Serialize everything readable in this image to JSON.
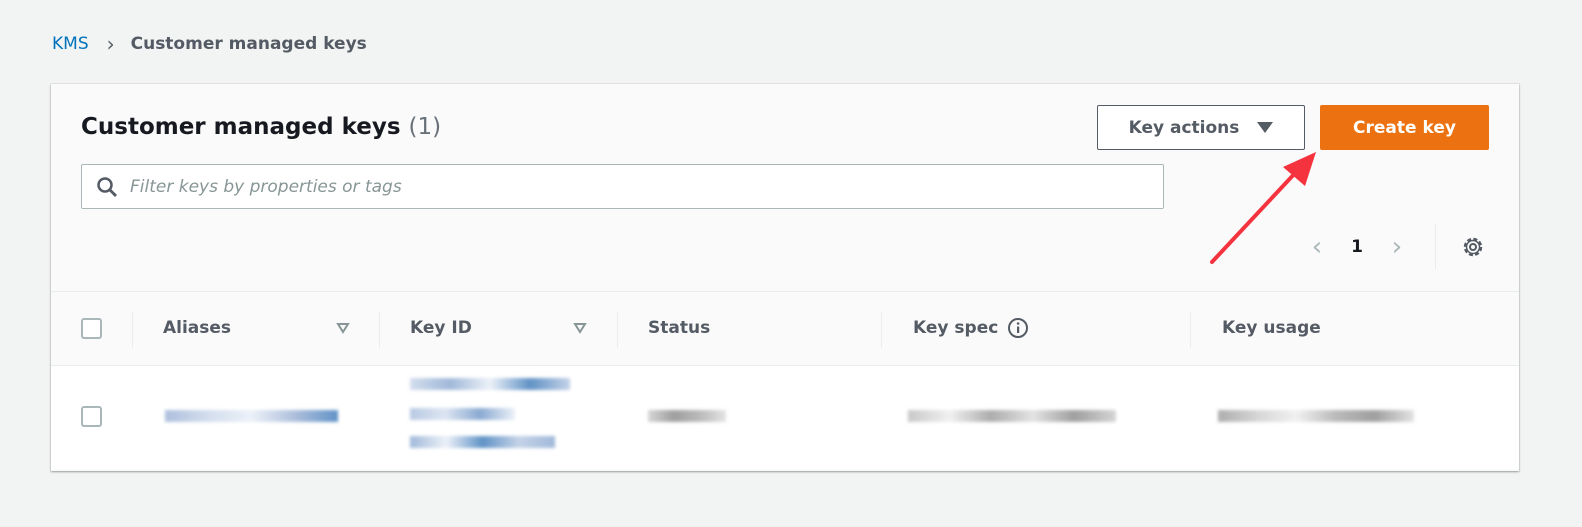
{
  "breadcrumb": {
    "root": "KMS",
    "current": "Customer managed keys"
  },
  "panel": {
    "title": "Customer managed keys",
    "count": "(1)"
  },
  "buttons": {
    "key_actions": "Key actions",
    "create_key": "Create key"
  },
  "search": {
    "placeholder": "Filter keys by properties or tags",
    "value": ""
  },
  "pagination": {
    "current_page": "1"
  },
  "table": {
    "columns": [
      "Aliases",
      "Key ID",
      "Status",
      "Key spec",
      "Key usage"
    ],
    "rows": [
      {
        "redacted": true
      }
    ]
  },
  "colors": {
    "accent": "#ec7211",
    "link": "#0073bb",
    "annotation_arrow": "#f5333f"
  },
  "icons": {
    "search": "search-icon",
    "settings": "gear-icon",
    "info": "info-icon",
    "filter": "sort-triangle-icon",
    "dropdown": "caret-down-icon"
  }
}
